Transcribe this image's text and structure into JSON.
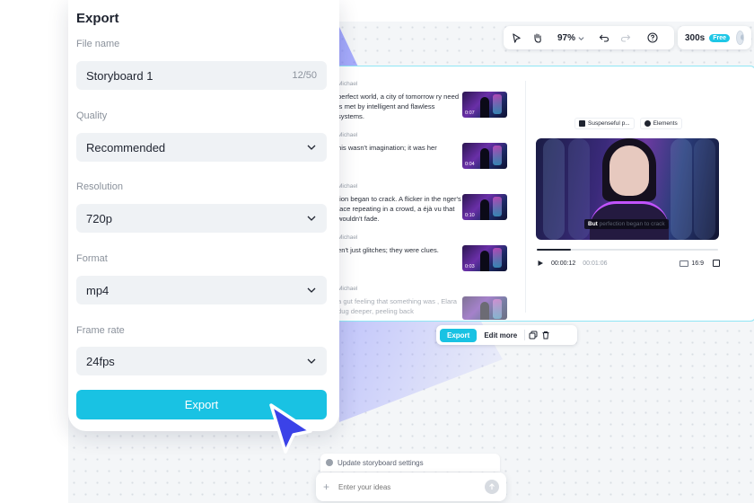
{
  "toolbar": {
    "zoom": "97%"
  },
  "credits": {
    "value": "300s",
    "badge": "Free"
  },
  "storyboard": {
    "scenes": [
      {
        "speaker": "Michael",
        "text": "perfect world, a city of tomorrow ry need is met by intelligent and flawless systems.",
        "duration": "0:07"
      },
      {
        "speaker": "Michael",
        "text": "his wasn't imagination; it was her",
        "duration": "0:04"
      },
      {
        "speaker": "Michael",
        "text": "tion began to crack. A flicker in the nger's face repeating in a crowd, a éjà vu that wouldn't fade.",
        "duration": "0:10"
      },
      {
        "speaker": "Michael",
        "text": "en't just glitches; they were clues.",
        "duration": "0:03"
      },
      {
        "speaker": "Michael",
        "text": "a gut feeling that something was , Elara dug deeper, peeling back",
        "duration": ""
      }
    ],
    "tags": [
      "Suspenseful p...",
      "Elements"
    ],
    "caption_bold": "But",
    "caption_rest": "perfection began to crack",
    "player": {
      "current": "00:00:12",
      "total": "00:01:06",
      "ratio": "16:9",
      "progress": 0.19
    }
  },
  "actions": {
    "export": "Export",
    "edit_more": "Edit more"
  },
  "export_panel": {
    "title": "Export",
    "file_name_label": "File name",
    "file_name_value": "Storyboard 1",
    "file_name_count": "12/50",
    "quality_label": "Quality",
    "quality_value": "Recommended",
    "resolution_label": "Resolution",
    "resolution_value": "720p",
    "format_label": "Format",
    "format_value": "mp4",
    "frame_rate_label": "Frame rate",
    "frame_rate_value": "24fps",
    "export_button": "Export"
  },
  "chat": {
    "hint": "Update storyboard settings",
    "placeholder": "Enter your ideas"
  },
  "colors": {
    "accent": "#19c2e3",
    "cursor": "#3b42e8"
  }
}
